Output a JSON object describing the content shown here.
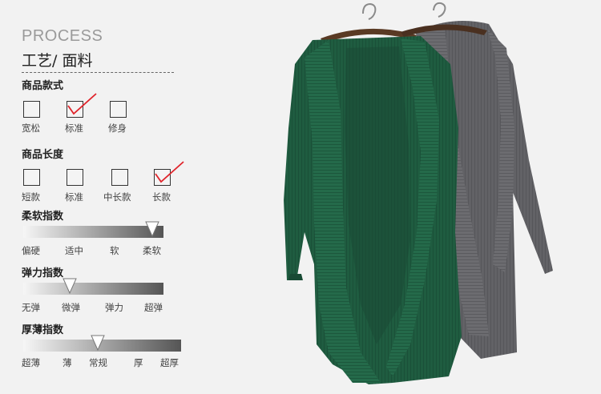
{
  "header": {
    "title_en": "PROCESS",
    "title_cn": "工艺/ 面料"
  },
  "style": {
    "label": "商品款式",
    "options": [
      "宽松",
      "标准",
      "修身"
    ],
    "selected_index": 1
  },
  "length": {
    "label": "商品长度",
    "options": [
      "短款",
      "标准",
      "中长款",
      "长款"
    ],
    "selected_index": 3
  },
  "softness": {
    "label": "柔软指数",
    "ticks": [
      "偏硬",
      "适中",
      "软",
      "柔软"
    ],
    "level": 0.92
  },
  "elasticity": {
    "label": "弹力指数",
    "ticks": [
      "无弹",
      "微弹",
      "弹力",
      "超弹"
    ],
    "level": 0.33
  },
  "thickness": {
    "label": "厚薄指数",
    "ticks": [
      "超薄",
      "薄",
      "常规",
      "厚",
      "超厚"
    ],
    "level": 0.47
  },
  "colors": {
    "check": "#e0242b",
    "green": "#1e5a3f",
    "grey": "#5f5f62",
    "hanger": "#5a3a24"
  }
}
